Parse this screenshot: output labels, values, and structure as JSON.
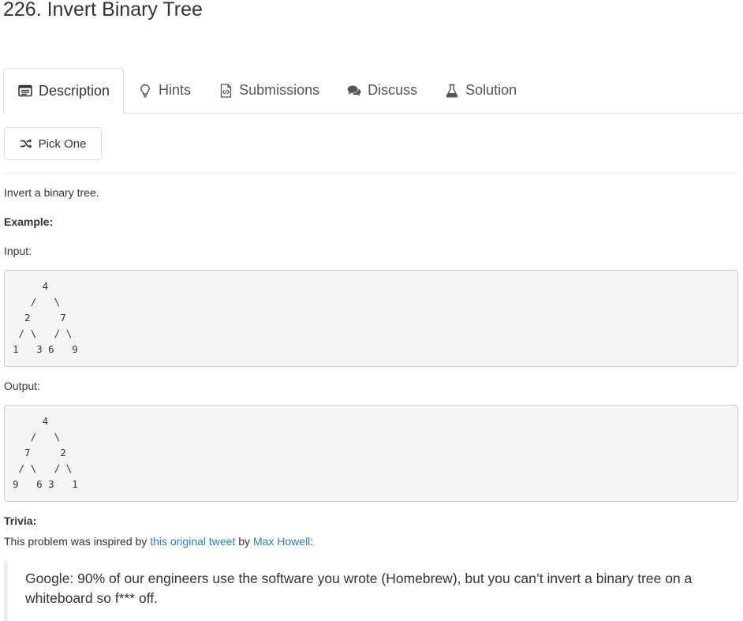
{
  "problem": {
    "title": "226. Invert Binary Tree"
  },
  "tabs": [
    {
      "label": "Description",
      "icon": "description-icon",
      "active": true
    },
    {
      "label": "Hints",
      "icon": "lightbulb-icon",
      "active": false
    },
    {
      "label": "Submissions",
      "icon": "code-file-icon",
      "active": false
    },
    {
      "label": "Discuss",
      "icon": "comments-icon",
      "active": false
    },
    {
      "label": "Solution",
      "icon": "flask-icon",
      "active": false
    }
  ],
  "pick_one": {
    "label": "Pick One",
    "icon": "shuffle-icon"
  },
  "content": {
    "intro": "Invert a binary tree.",
    "example_label": "Example:",
    "input_label": "Input:",
    "input_tree": "     4\n   /   \\\n  2     7\n / \\   / \\\n1   3 6   9",
    "output_label": "Output:",
    "output_tree": "     4\n   /   \\\n  7     2\n / \\   / \\\n9   6 3   1",
    "trivia_label": "Trivia:",
    "trivia_prefix": "This problem was inspired by ",
    "trivia_link1": "this original tweet",
    "trivia_middle": " by ",
    "trivia_link2": "Max Howell",
    "trivia_suffix": ":",
    "quote": "Google: 90% of our engineers use the software you wrote (Homebrew), but you can’t invert a binary tree on a whiteboard so f*** off."
  },
  "colors": {
    "link": "#337ab7",
    "code_bg": "#f5f5f5",
    "border": "#dddddd"
  }
}
